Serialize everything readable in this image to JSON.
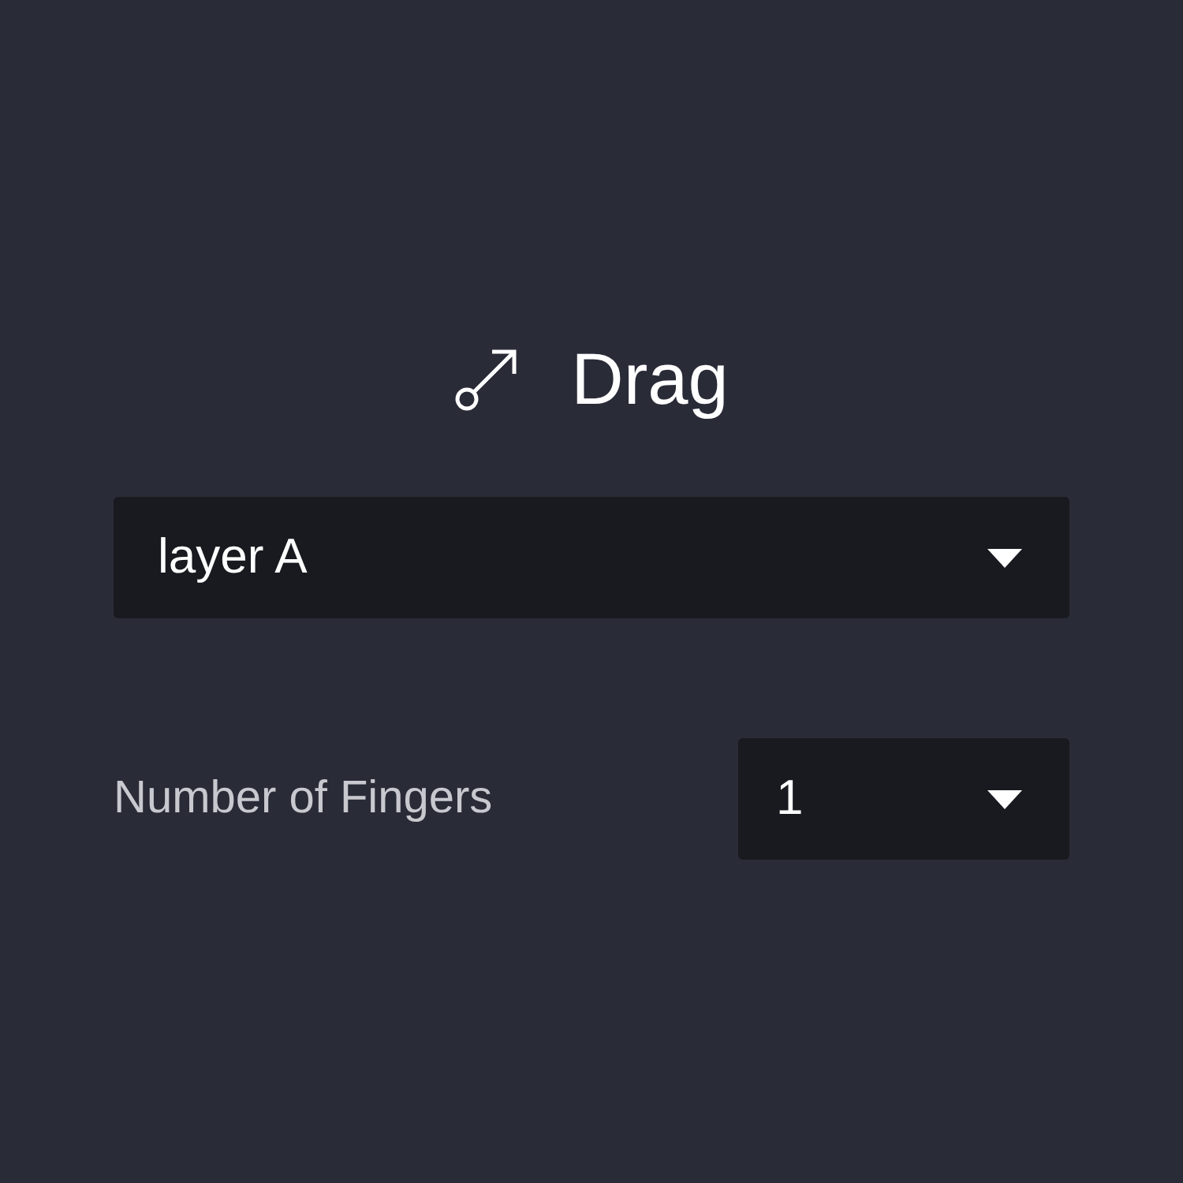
{
  "title": "Drag",
  "layer_select": {
    "value": "layer A"
  },
  "fingers": {
    "label": "Number of Fingers",
    "value": "1"
  }
}
